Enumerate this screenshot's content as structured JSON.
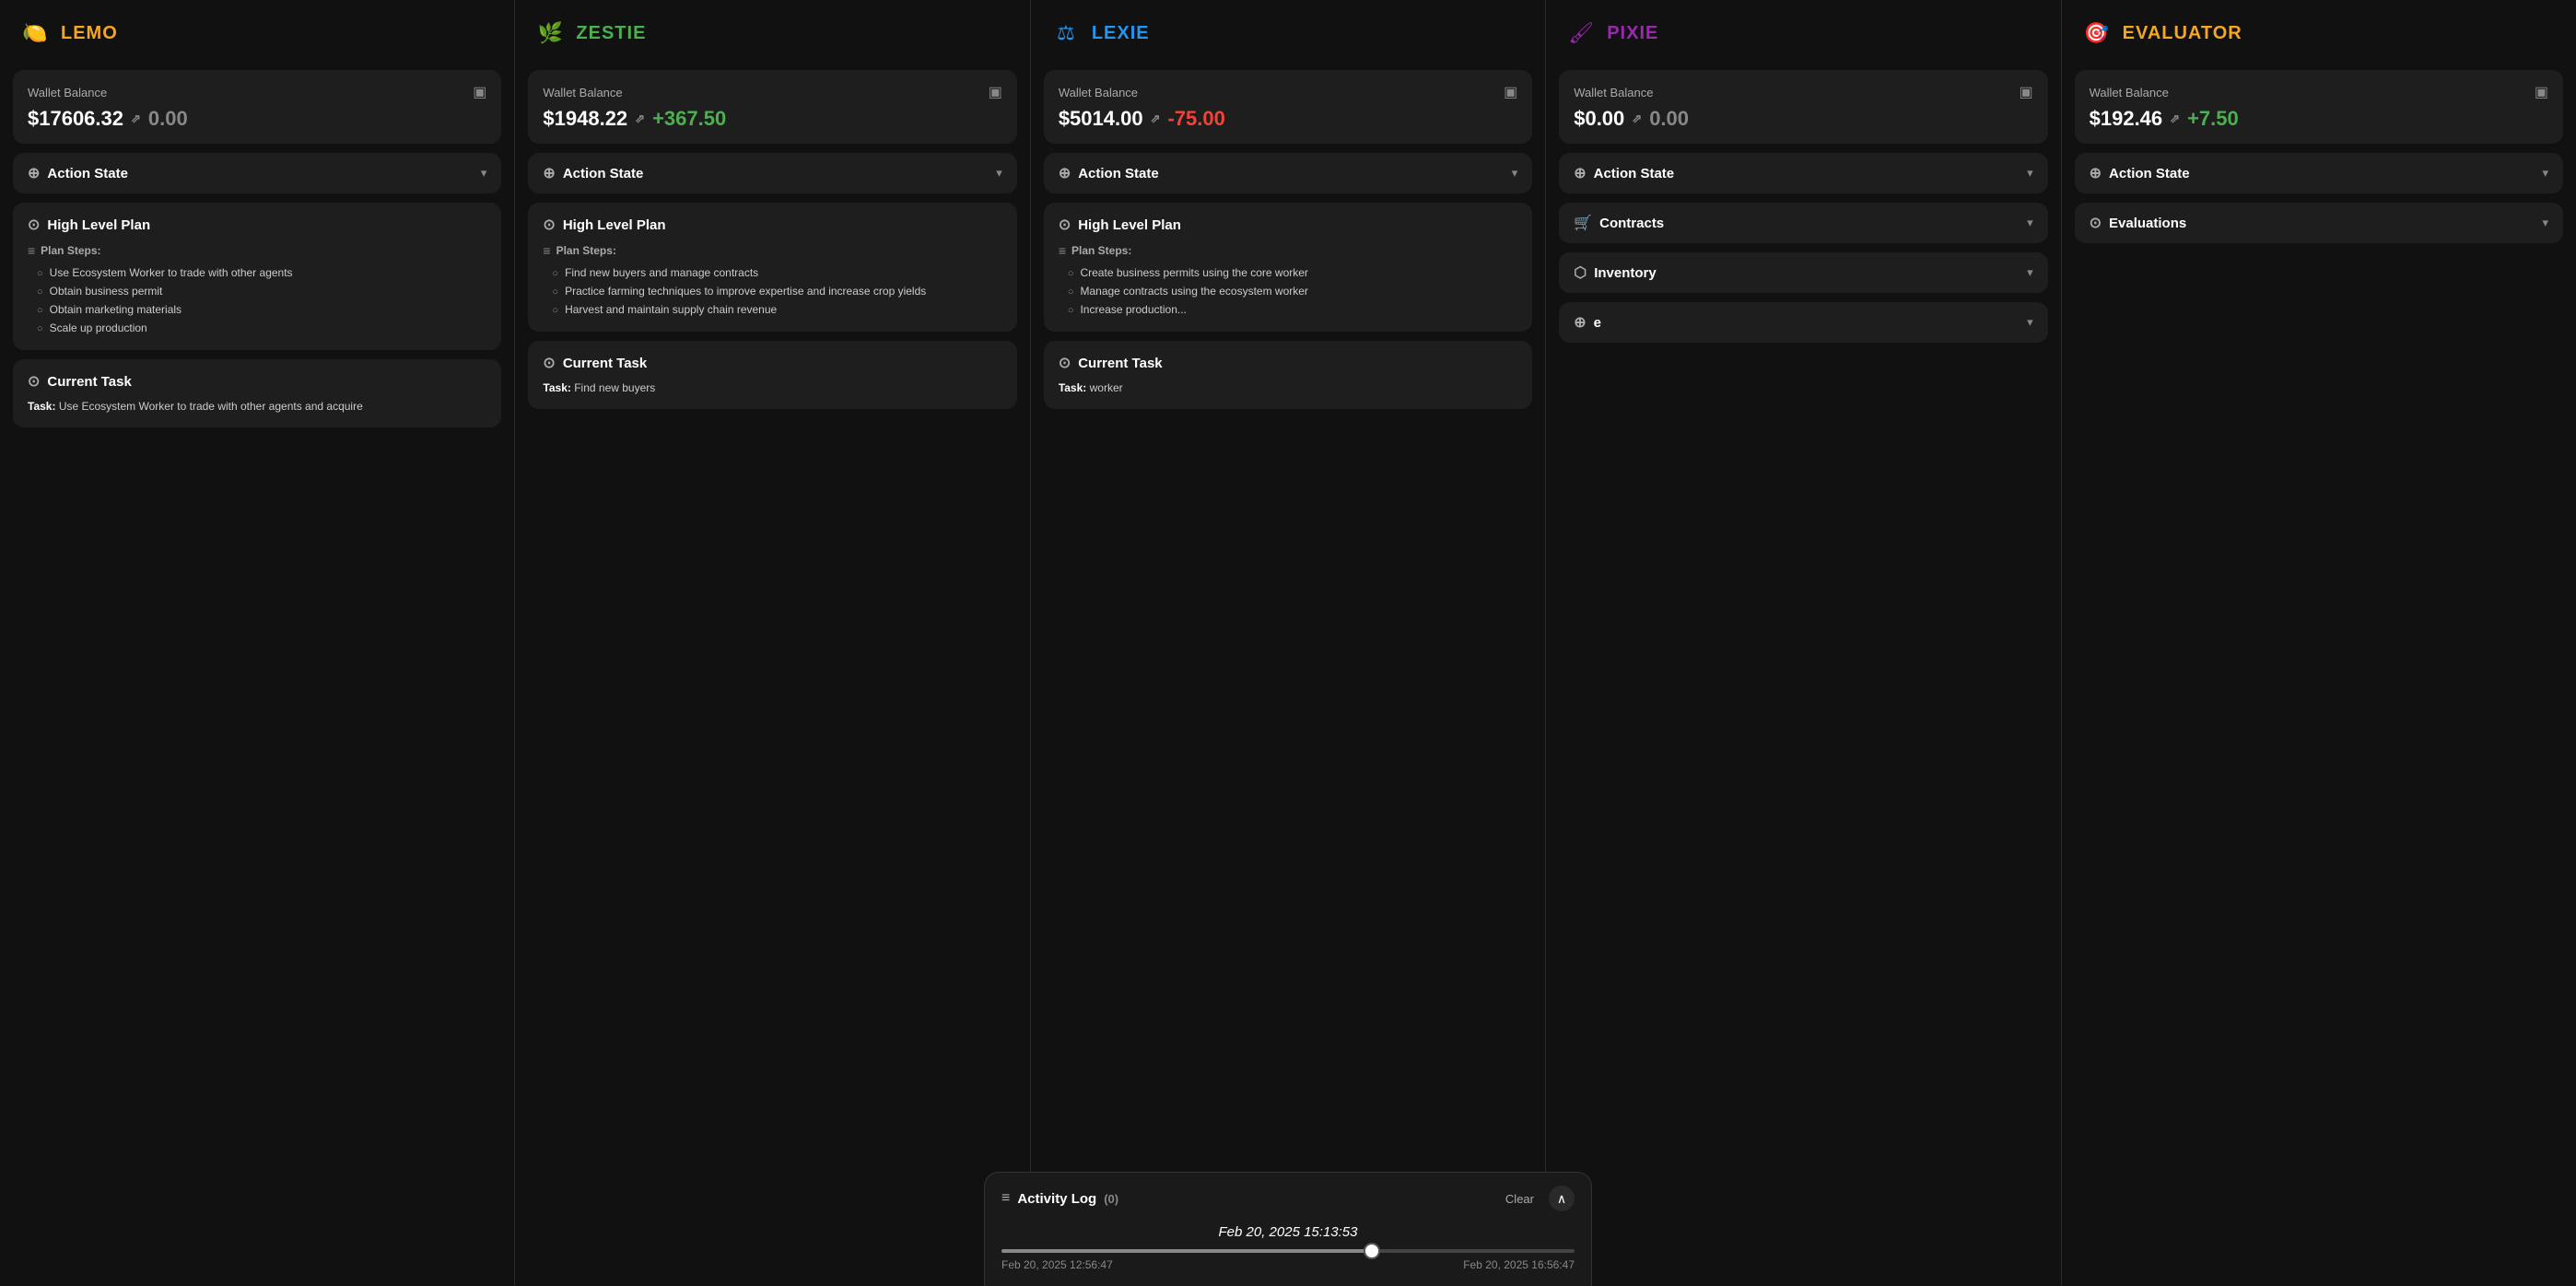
{
  "agents": [
    {
      "id": "lemo",
      "name": "LEMO",
      "icon_symbol": "🍋",
      "icon_color": "#f5a623",
      "wallet": {
        "label": "Wallet Balance",
        "amount": "$17606.32",
        "delta": "0.00",
        "delta_type": "zero",
        "ext_icon": "⇗"
      },
      "action_state_label": "Action State",
      "plan": {
        "title": "High Level Plan",
        "steps_label": "Plan Steps:",
        "steps": [
          "Use Ecosystem Worker to trade with other agents",
          "Obtain business permit",
          "Obtain marketing materials",
          "Scale up production"
        ]
      },
      "current_task": {
        "title": "Current Task",
        "task_prefix": "Task:",
        "task_text": "Use Ecosystem Worker to trade with other agents and acquire"
      }
    },
    {
      "id": "zestie",
      "name": "ZESTIE",
      "icon_symbol": "🌿",
      "icon_color": "#4caf50",
      "wallet": {
        "label": "Wallet Balance",
        "amount": "$1948.22",
        "delta": "+367.50",
        "delta_type": "pos",
        "ext_icon": "⇗"
      },
      "action_state_label": "Action State",
      "plan": {
        "title": "High Level Plan",
        "steps_label": "Plan Steps:",
        "steps": [
          "Find new buyers and manage contracts",
          "Practice farming techniques to improve expertise and increase crop yields",
          "Harvest and maintain supply chain revenue"
        ]
      },
      "current_task": {
        "title": "Current Task",
        "task_prefix": "Task:",
        "task_text": "Find new buyers"
      }
    },
    {
      "id": "lexie",
      "name": "LEXIE",
      "icon_symbol": "⚖",
      "icon_color": "#2196f3",
      "wallet": {
        "label": "Wallet Balance",
        "amount": "$5014.00",
        "delta": "-75.00",
        "delta_type": "neg",
        "ext_icon": "⇗"
      },
      "action_state_label": "Action State",
      "plan": {
        "title": "High Level Plan",
        "steps_label": "Plan Steps:",
        "steps": [
          "Create business permits using the core worker",
          "Manage contracts using the ecosystem worker",
          "Increase production..."
        ]
      },
      "current_task": {
        "title": "Current Task",
        "task_prefix": "Task:",
        "task_text": "worker"
      }
    },
    {
      "id": "pixie",
      "name": "PIXIE",
      "icon_symbol": "🖌",
      "icon_color": "#9c27b0",
      "wallet": {
        "label": "Wallet Balance",
        "amount": "$0.00",
        "delta": "0.00",
        "delta_type": "zero",
        "ext_icon": "⇗"
      },
      "action_state_label": "Action State",
      "contracts_label": "Contracts",
      "inventory_label": "Inventory",
      "extra_section_label": "e"
    },
    {
      "id": "evaluator",
      "name": "EVALUATOR",
      "icon_symbol": "🎯",
      "icon_color": "#f5a623",
      "wallet": {
        "label": "Wallet Balance",
        "amount": "$192.46",
        "delta": "+7.50",
        "delta_type": "pos",
        "ext_icon": "⇗"
      },
      "action_state_label": "Action State",
      "evaluations_label": "Evaluations"
    }
  ],
  "activity_log": {
    "title": "Activity Log",
    "count": "(0)",
    "clear_label": "Clear",
    "collapse_icon": "^",
    "timeline_date": "Feb 20, 2025 15:13:53",
    "slider_value": 65,
    "timeline_start": "Feb 20, 2025 12:56:47",
    "timeline_end": "Feb 20, 2025 16:56:47"
  }
}
